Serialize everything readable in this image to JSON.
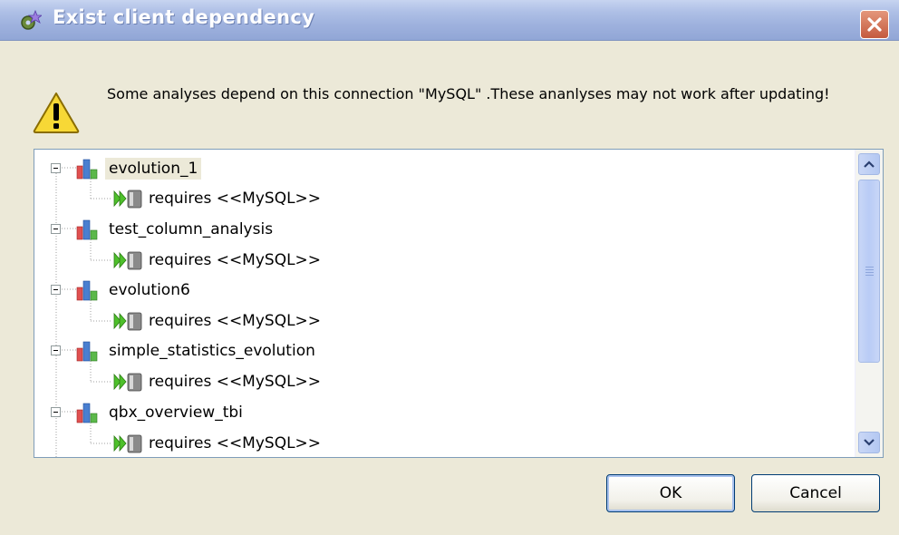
{
  "window": {
    "title": "Exist client dependency",
    "app_icon": "gear-star-icon",
    "close_icon": "close-icon"
  },
  "message": {
    "icon": "warning-icon",
    "text": "Some analyses depend on this connection \"MySQL\" .These ananlyses may not work after updating!"
  },
  "tree": {
    "items": [
      {
        "label": "evolution_1",
        "selected": true,
        "child": "requires <<MySQL>>"
      },
      {
        "label": "test_column_analysis",
        "selected": false,
        "child": "requires <<MySQL>>"
      },
      {
        "label": "evolution6",
        "selected": false,
        "child": "requires <<MySQL>>"
      },
      {
        "label": "simple_statistics_evolution",
        "selected": false,
        "child": "requires <<MySQL>>"
      },
      {
        "label": "qbx_overview_tbi",
        "selected": false,
        "child": "requires <<MySQL>>"
      }
    ]
  },
  "buttons": {
    "ok": "OK",
    "cancel": "Cancel"
  },
  "colors": {
    "titlebar": "#9fb2de",
    "background": "#ece9d8",
    "close_button": "#c45a3e"
  }
}
